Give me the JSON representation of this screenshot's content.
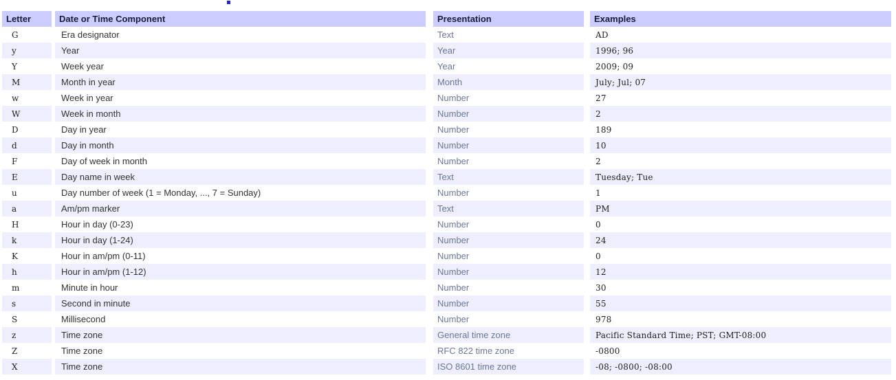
{
  "table": {
    "headers": {
      "letter": "Letter",
      "component": "Date or Time Component",
      "presentation": "Presentation",
      "examples": "Examples"
    },
    "rows": [
      {
        "letter": "G",
        "component": "Era designator",
        "presentation": "Text",
        "examples": "AD"
      },
      {
        "letter": "y",
        "component": "Year",
        "presentation": "Year",
        "examples": "1996; 96"
      },
      {
        "letter": "Y",
        "component": "Week year",
        "presentation": "Year",
        "examples": "2009; 09"
      },
      {
        "letter": "M",
        "component": "Month in year",
        "presentation": "Month",
        "examples": "July; Jul; 07"
      },
      {
        "letter": "w",
        "component": "Week in year",
        "presentation": "Number",
        "examples": "27"
      },
      {
        "letter": "W",
        "component": "Week in month",
        "presentation": "Number",
        "examples": "2"
      },
      {
        "letter": "D",
        "component": "Day in year",
        "presentation": "Number",
        "examples": "189"
      },
      {
        "letter": "d",
        "component": "Day in month",
        "presentation": "Number",
        "examples": "10"
      },
      {
        "letter": "F",
        "component": "Day of week in month",
        "presentation": "Number",
        "examples": "2"
      },
      {
        "letter": "E",
        "component": "Day name in week",
        "presentation": "Text",
        "examples": "Tuesday; Tue"
      },
      {
        "letter": "u",
        "component": "Day number of week (1 = Monday, ..., 7 = Sunday)",
        "presentation": "Number",
        "examples": "1"
      },
      {
        "letter": "a",
        "component": "Am/pm marker",
        "presentation": "Text",
        "examples": "PM"
      },
      {
        "letter": "H",
        "component": "Hour in day (0-23)",
        "presentation": "Number",
        "examples": "0"
      },
      {
        "letter": "k",
        "component": "Hour in day (1-24)",
        "presentation": "Number",
        "examples": "24"
      },
      {
        "letter": "K",
        "component": "Hour in am/pm (0-11)",
        "presentation": "Number",
        "examples": "0"
      },
      {
        "letter": "h",
        "component": "Hour in am/pm (1-12)",
        "presentation": "Number",
        "examples": "12"
      },
      {
        "letter": "m",
        "component": "Minute in hour",
        "presentation": "Number",
        "examples": "30"
      },
      {
        "letter": "s",
        "component": "Second in minute",
        "presentation": "Number",
        "examples": "55"
      },
      {
        "letter": "S",
        "component": "Millisecond",
        "presentation": "Number",
        "examples": "978"
      },
      {
        "letter": "z",
        "component": "Time zone",
        "presentation": "General time zone",
        "examples": "Pacific Standard Time; PST; GMT-08:00"
      },
      {
        "letter": "Z",
        "component": "Time zone",
        "presentation": "RFC 822 time zone",
        "examples": "-0800"
      },
      {
        "letter": "X",
        "component": "Time zone",
        "presentation": "ISO 8601 time zone",
        "examples": "-08; -0800; -08:00"
      }
    ]
  },
  "colors": {
    "header_background": "#ccccff",
    "row_stripe": "#eeeeff",
    "row_base": "#ffffff",
    "presentation_text": "#6b7799",
    "body_text": "#333333",
    "header_text": "#1a1a3a"
  }
}
